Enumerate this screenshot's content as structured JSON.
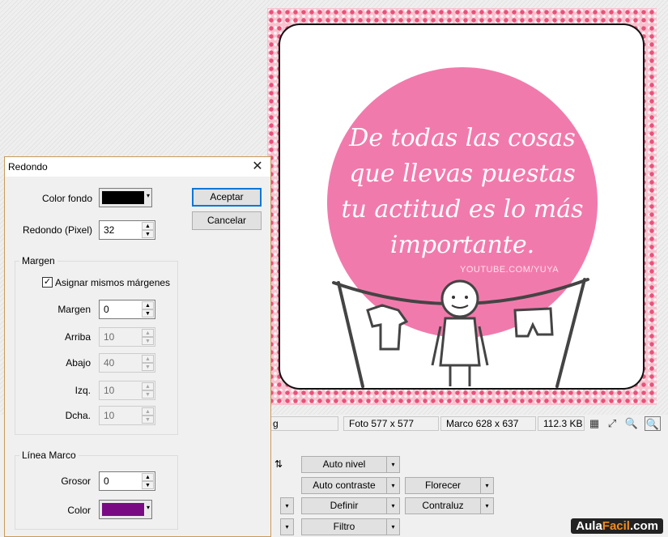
{
  "dialog": {
    "title": "Redondo",
    "close_glyph": "✕",
    "color_fondo_label": "Color fondo",
    "color_fondo_value": "#000000",
    "redondo_label": "Redondo (Pixel)",
    "redondo_value": "32",
    "accept_label": "Aceptar",
    "cancel_label": "Cancelar",
    "margen_group": {
      "title": "Margen",
      "same_margins_label": "Asignar mismos márgenes",
      "same_margins_checked": true,
      "margen_label": "Margen",
      "margen_value": "0",
      "arriba_label": "Arriba",
      "arriba_value": "10",
      "abajo_label": "Abajo",
      "abajo_value": "40",
      "izq_label": "Izq.",
      "izq_value": "10",
      "dcha_label": "Dcha.",
      "dcha_value": "10"
    },
    "linea_group": {
      "title": "Línea Marco",
      "grosor_label": "Grosor",
      "grosor_value": "0",
      "color_label": "Color",
      "color_value": "#7a0a84"
    }
  },
  "photo": {
    "quote_lines": [
      "De todas las cosas",
      "que llevas puestas",
      "tu actitud es lo más",
      "importante."
    ],
    "credit": "YOUTUBE.COM/YUYA"
  },
  "status_bar": {
    "filename_fragment": "g",
    "photo_size": "Foto 577 x 577",
    "frame_size": "Marco 628 x 637",
    "file_size": "112.3 KB"
  },
  "tools": {
    "auto_nivel": "Auto nivel",
    "auto_contraste": "Auto contraste",
    "definir": "Definir",
    "filtro": "Filtro",
    "florecer": "Florecer",
    "contraluz": "Contraluz"
  },
  "watermark": {
    "part1": "Aula",
    "part2": "Facil",
    "part3": ".com"
  },
  "icons": {
    "dropdown": "▾",
    "spin_up": "▲",
    "spin_down": "▼",
    "checkmark": "✓",
    "flip": "⇅",
    "zoom_in": "🔍",
    "fit": "⤢",
    "checker": "▦"
  }
}
